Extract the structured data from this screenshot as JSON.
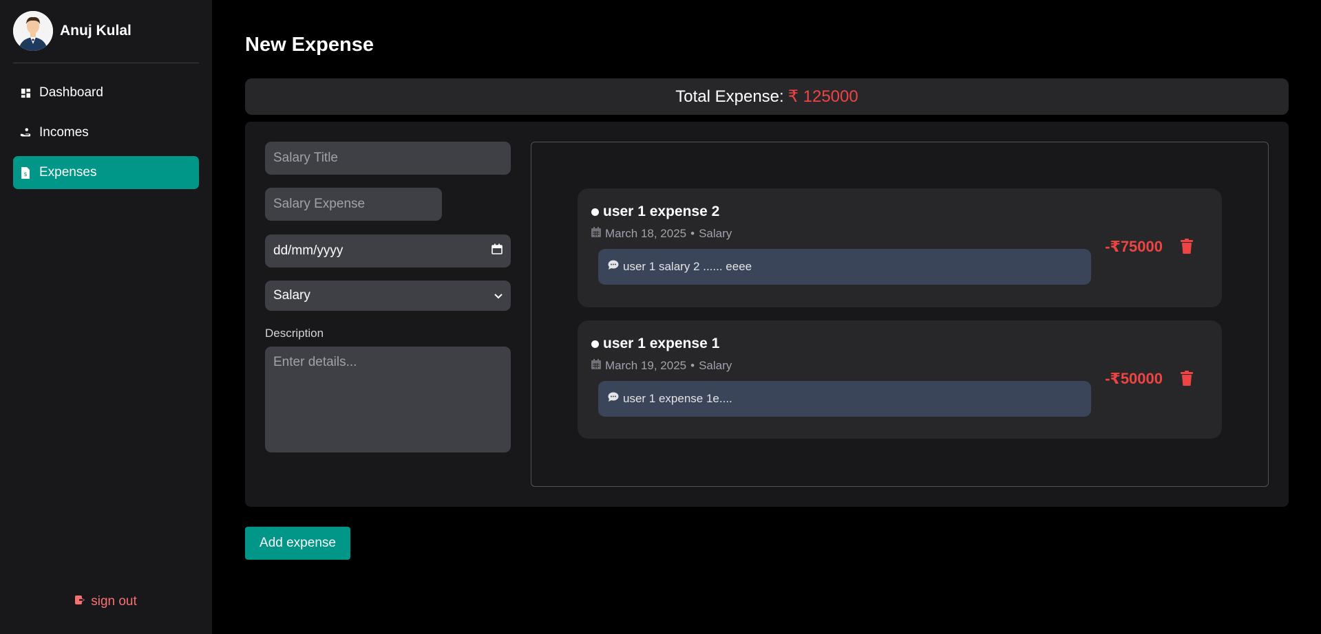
{
  "user": {
    "name": "Anuj Kulal"
  },
  "nav": [
    {
      "label": "Dashboard",
      "icon": "dashboard-icon",
      "active": false
    },
    {
      "label": "Incomes",
      "icon": "hand-coin-icon",
      "active": false
    },
    {
      "label": "Expenses",
      "icon": "receipt-icon",
      "active": true
    }
  ],
  "signout": {
    "label": "sign out",
    "icon": "sign-out-icon"
  },
  "page": {
    "title": "New Expense"
  },
  "total": {
    "label": "Total Expense:",
    "amount": "₹ 125000"
  },
  "form": {
    "title_placeholder": "Salary Title",
    "amount_placeholder": "Salary Expense",
    "date_placeholder": "dd/mm/yyyy",
    "category_value": "Salary",
    "description_label": "Description",
    "description_placeholder": "Enter details..."
  },
  "expenses": [
    {
      "title": "user 1 expense 2",
      "date": "March 18, 2025",
      "category": "Salary",
      "note": "user 1 salary 2 ...... eeee",
      "amount": "-₹75000"
    },
    {
      "title": "user 1 expense 1",
      "date": "March 19, 2025",
      "category": "Salary",
      "note": "user 1 expense 1e....",
      "amount": "-₹50000"
    }
  ],
  "actions": {
    "add_label": "Add expense"
  },
  "colors": {
    "accent": "#009688",
    "danger": "#ef4444",
    "bg": "#000000",
    "sidebar": "#18181b"
  }
}
